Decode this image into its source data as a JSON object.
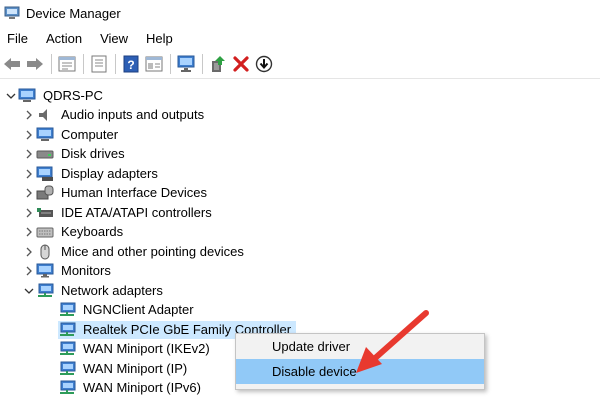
{
  "window": {
    "title": "Device Manager"
  },
  "menubar": {
    "items": [
      "File",
      "Action",
      "View",
      "Help"
    ]
  },
  "toolbar": {
    "buttons": [
      "back-icon",
      "forward-icon",
      "properties-icon",
      "window-icon",
      "help-icon",
      "view-icon",
      "monitor-scan-icon",
      "update-driver-icon",
      "uninstall-icon",
      "disable-icon"
    ]
  },
  "tree": {
    "root": "QDRS-PC",
    "categories": [
      "Audio inputs and outputs",
      "Computer",
      "Disk drives",
      "Display adapters",
      "Human Interface Devices",
      "IDE ATA/ATAPI controllers",
      "Keyboards",
      "Mice and other pointing devices",
      "Monitors",
      "Network adapters"
    ],
    "network_children": [
      "NGNClient Adapter",
      "Realtek PCIe GbE Family Controller",
      "WAN Miniport (IKEv2)",
      "WAN Miniport (IP)",
      "WAN Miniport (IPv6)"
    ]
  },
  "context_menu": {
    "items": [
      "Update driver",
      "Disable device"
    ]
  },
  "colors": {
    "selection": "#cce8ff",
    "menu_hover": "#91c9f7",
    "annotation_arrow": "#e8392f"
  }
}
